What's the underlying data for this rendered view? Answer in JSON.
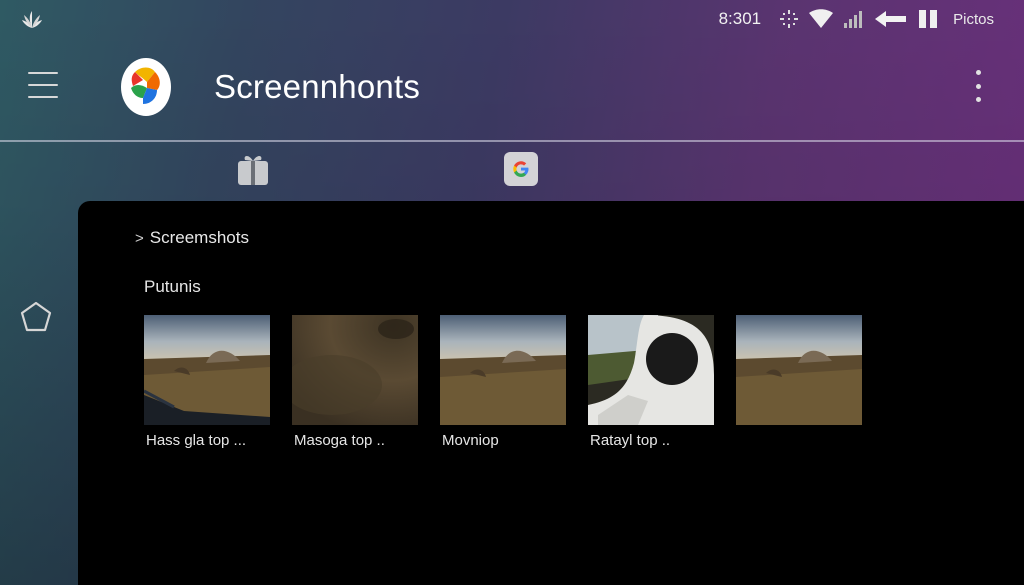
{
  "status_bar": {
    "time": "8:301",
    "carrier": "Pictos",
    "icons": [
      "leaf-icon",
      "bluetooth-sparkle-icon",
      "wifi-icon",
      "signal-icon",
      "back-arrow-icon",
      "pause-icon"
    ]
  },
  "app_bar": {
    "title": "Screennhonts",
    "menu_icon": "hamburger-menu-icon",
    "logo_icon": "photos-logo-icon",
    "overflow_icon": "more-vert-icon"
  },
  "shortcuts": [
    {
      "icon": "gift-icon"
    },
    {
      "icon": "google-icon",
      "glyph": "G"
    }
  ],
  "rail": {
    "icon": "pentagon-icon"
  },
  "panel": {
    "breadcrumb": {
      "chevron": ">",
      "label": "Screemshots"
    },
    "section_title": "Putunis",
    "items": [
      {
        "caption": "Hass gla top ...",
        "thumb": "landscape-rock-car-window"
      },
      {
        "caption": "Masoga top ..",
        "thumb": "blurred-ground"
      },
      {
        "caption": "Movniop",
        "thumb": "landscape-rock"
      },
      {
        "caption": "Ratayl top ..",
        "thumb": "car-interior-window"
      },
      {
        "caption": "",
        "thumb": "landscape-rock"
      }
    ]
  },
  "colors": {
    "background_start": "#2f5a63",
    "background_end": "#6b2f7c",
    "panel": "#000000",
    "text": "#ffffff"
  }
}
